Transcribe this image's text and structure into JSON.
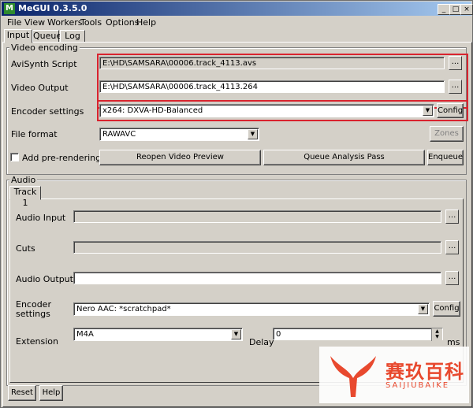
{
  "window": {
    "title": "MeGUI 0.3.5.0",
    "app_icon": "megui-logo-icon"
  },
  "menubar": [
    "File",
    "View",
    "Workers",
    "Tools",
    "Options",
    "Help"
  ],
  "tabs": [
    "Input",
    "Queue",
    "Log"
  ],
  "video": {
    "group_title": "Video encoding",
    "avisynth_label": "AviSynth Script",
    "avisynth_value": "E:\\HD\\SAMSARA\\00006.track_4113.avs",
    "output_label": "Video Output",
    "output_value": "E:\\HD\\SAMSARA\\00006.track_4113.264",
    "encoder_label": "Encoder settings",
    "encoder_value": "x264: DXVA-HD-Balanced",
    "config_label": "Config",
    "format_label": "File format",
    "format_value": "RAWAVC",
    "zones_label": "Zones",
    "prerender_label": "Add pre-rendering job",
    "reopen_label": "Reopen Video Preview",
    "analysis_label": "Queue Analysis Pass",
    "enqueue_label": "Enqueue",
    "browse_label": "..."
  },
  "audio": {
    "group_title": "Audio",
    "track_tab": "Track 1",
    "input_label": "Audio Input",
    "cuts_label": "Cuts",
    "output_label": "Audio Output",
    "encoder_label_1": "Encoder",
    "encoder_label_2": "settings",
    "encoder_value": "Nero AAC: *scratchpad*",
    "config_label": "Config",
    "extension_label": "Extension",
    "extension_value": "M4A",
    "delay_label": "Delay",
    "delay_value": "0",
    "ms_label": "ms",
    "browse_label": "..."
  },
  "bottom": {
    "reset_label": "Reset",
    "help_label": "Help"
  },
  "watermark": {
    "text": "赛玖百科",
    "sub": "SAIJIUBAIKE"
  },
  "colors": {
    "highlight": "#d9232e",
    "titlebar": "#0a246a",
    "watermark": "#e8492e"
  }
}
